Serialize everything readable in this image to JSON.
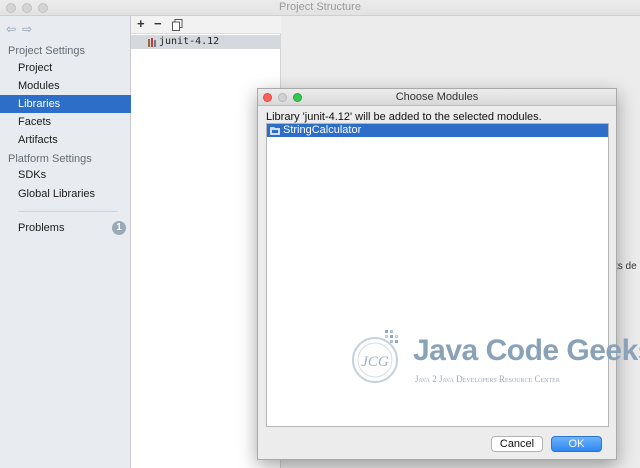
{
  "window": {
    "title": "Project Structure"
  },
  "sidebar": {
    "project_settings_header": "Project Settings",
    "platform_settings_header": "Platform Settings",
    "items": [
      {
        "label": "Project"
      },
      {
        "label": "Modules"
      },
      {
        "label": "Libraries",
        "selected": true
      },
      {
        "label": "Facets"
      },
      {
        "label": "Artifacts"
      },
      {
        "label": "SDKs"
      },
      {
        "label": "Global Libraries"
      },
      {
        "label": "Problems",
        "badge": "1"
      }
    ]
  },
  "library_panel": {
    "toolbar": {
      "add": "+",
      "remove": "−",
      "copy_icon": "copy-icon"
    },
    "libraries": [
      {
        "label": "junit-4.12",
        "icon": "library-icon"
      }
    ]
  },
  "right_area": {
    "partial_text": "ts de"
  },
  "dialog": {
    "title": "Choose Modules",
    "message": "Library 'junit-4.12' will be added to the selected modules.",
    "modules": [
      {
        "label": "StringCalculator",
        "icon": "module-folder-icon",
        "selected": true
      }
    ],
    "cancel_label": "Cancel",
    "ok_label": "OK"
  },
  "watermark": {
    "title": "Java Code Geeks",
    "subtitle": "Java 2 Java Developers Resource Center",
    "logo_text": "JCG"
  },
  "colors": {
    "selection": "#2d6ec9",
    "ok_button": "#2f87f0",
    "close_light": "#fc605c",
    "min_light": "#fdbc40",
    "max_light": "#34c84a"
  }
}
